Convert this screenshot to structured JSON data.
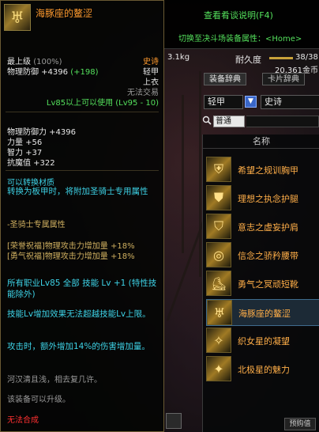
{
  "tooltip": {
    "item_name": "海豚座的鳌涩",
    "icon": "dolphin-constellation-gear-icon",
    "max_level_label": "最上级",
    "max_level_pct": "(100%)",
    "rarity": "史诗",
    "phys_def": "物理防御 +4396",
    "phys_def_bonus": "(+198)",
    "armor_type": "轻甲",
    "slot": "上衣",
    "trade": "无法交易",
    "level_req": "Lv85以上可以使用 (Lv95 - 10)",
    "stats": [
      "物理防御力 +4396",
      "力量 +56",
      "智力 +37",
      "抗魔值 +322"
    ],
    "convertible": "可以转换材质",
    "convert_desc": "转换为板甲时，将附加圣骑士专用属性",
    "paladin_title": "-圣骑士专属属性",
    "paladin_lines": [
      "[荣誉祝福]物理攻击力增加量 +18%",
      "[勇气祝福]物理攻击力增加量 +18%"
    ],
    "skill_line": "所有职业Lv85 全部 技能 Lv +1 (特性技能除外)",
    "skill_limit": "技能Lv增加效果无法超越技能Lv上限。",
    "damage_line": "攻击时，额外增加14%的伤害增加量。",
    "flavor": "河汉清且浅，相去复几许。",
    "upgrade": "该装备可以升级。",
    "no_synth": "无法合成"
  },
  "window": {
    "help_link": "查看肴谈说明(F4)",
    "switch_link": "切换至决斗场装备属性：<Home>",
    "weight": "3.1kg",
    "durability_label": "耐久度",
    "durability_value": "38/38",
    "durability_fraction": 1.0,
    "gold": "20,361金币",
    "tabs": [
      "装备辞典",
      "卡片辞典"
    ],
    "filter_type": "轻甲",
    "filter_rarity": "史诗",
    "search_text": "普通",
    "list_header": "名称",
    "items": [
      {
        "label": "希望之规训胸甲",
        "icon": "breastplate-icon"
      },
      {
        "label": "理想之执念护腿",
        "icon": "leggings-icon"
      },
      {
        "label": "意志之虚妄护肩",
        "icon": "shoulder-icon"
      },
      {
        "label": "信念之骄矜腰带",
        "icon": "belt-icon"
      },
      {
        "label": "勇气之冥顽短靴",
        "icon": "boots-icon"
      },
      {
        "label": "海豚座的鳌涩",
        "icon": "dolphin-gear-icon"
      },
      {
        "label": "织女星的凝望",
        "icon": "vega-icon"
      },
      {
        "label": "北极星的魅力",
        "icon": "polaris-icon"
      }
    ],
    "bottom_button": "预购值"
  },
  "colors": {
    "rarity_epic": "#ff9a2e",
    "link_green": "#54e05c",
    "stat_cyan": "#3dd2e6",
    "warning_red": "#ff3030"
  }
}
